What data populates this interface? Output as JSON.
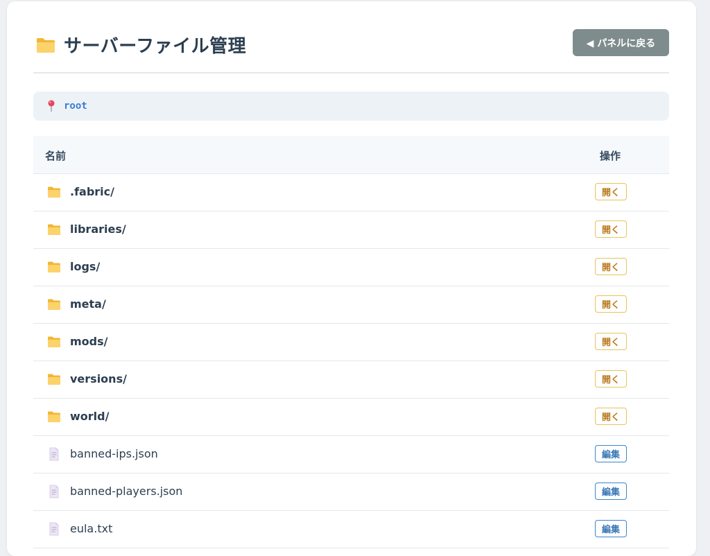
{
  "header": {
    "title": "サーバーファイル管理",
    "back_label": "◀ パネルに戻る"
  },
  "path": {
    "current": "root"
  },
  "table": {
    "columns": {
      "name": "名前",
      "ops": "操作"
    },
    "rows": [
      {
        "name": ".fabric/",
        "type": "folder",
        "action": "開く"
      },
      {
        "name": "libraries/",
        "type": "folder",
        "action": "開く"
      },
      {
        "name": "logs/",
        "type": "folder",
        "action": "開く"
      },
      {
        "name": "meta/",
        "type": "folder",
        "action": "開く"
      },
      {
        "name": "mods/",
        "type": "folder",
        "action": "開く"
      },
      {
        "name": "versions/",
        "type": "folder",
        "action": "開く"
      },
      {
        "name": "world/",
        "type": "folder",
        "action": "開く"
      },
      {
        "name": "banned-ips.json",
        "type": "file",
        "action": "編集"
      },
      {
        "name": "banned-players.json",
        "type": "file",
        "action": "編集"
      },
      {
        "name": "eula.txt",
        "type": "file",
        "action": "編集"
      }
    ]
  },
  "colors": {
    "folder": "#f7c244",
    "back_button": "#7f8c8d",
    "open_border": "#e7c35a",
    "edit_border": "#3a86c8",
    "path_text": "#3a7bd5"
  },
  "icons": {
    "title": "folder-icon",
    "path": "pin-icon",
    "folder_row": "folder-icon",
    "file_row": "file-icon"
  }
}
